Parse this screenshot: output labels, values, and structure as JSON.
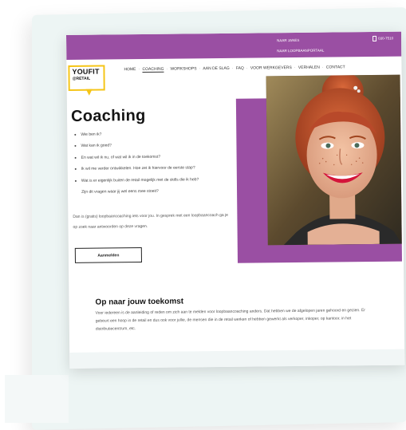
{
  "topbar": {
    "link_1": "NAAR JANES",
    "link_2": "NAAR LOOPBAANPORTAAL",
    "phone": "030-7510"
  },
  "logo": {
    "line_1": "YOUFIT",
    "line_2": "@RETAIL"
  },
  "nav": {
    "items": [
      "HOME",
      "COACHING",
      "WORKSHOPS",
      "AAN DE SLAG",
      "FAQ",
      "VOOR WERKGEVERS",
      "VERHALEN",
      "CONTACT"
    ],
    "active": "COACHING"
  },
  "hero": {
    "title": "Coaching",
    "bullets": [
      "Wie ben ik?",
      "Wat kan ik goed?",
      "En wat wil ik nu, of wat wil ik in de toekomst?",
      "Ik wil me verder ontwikkelen. Hoe zet ik hiervoor de eerste stap?",
      "Wat is er eigenlijk buiten de retail mogelijk met de skills die ik heb?"
    ],
    "bullet_continuation": "Zijn dit vragen waar jij wel eens mee stoeit?",
    "intro": "Dan is (gratis) loopbaancoaching iets voor jou. In gesprek met een loopbaancoach ga je op zoek naar antwoorden op deze vragen.",
    "cta_label": "Aanmelden"
  },
  "section": {
    "title": "Op naar jouw toekomst",
    "text": "Voor iedereen is de aanleiding of reden om zich aan te melden voor loopbaancoaching anders. Dat hebben we de afgelopen jaren gehoord en gezien. Er gebeurt een hoop in de retail en dus ook voor jullie, de mensen die in de retail werken of hebben gewerkt als verkoper, inkoper, op kantoor, in het distributiecentrum, etc."
  },
  "colors": {
    "brand_purple": "#9a4fa3",
    "logo_yellow": "#f5c518",
    "backdrop": "#edf5f4"
  }
}
